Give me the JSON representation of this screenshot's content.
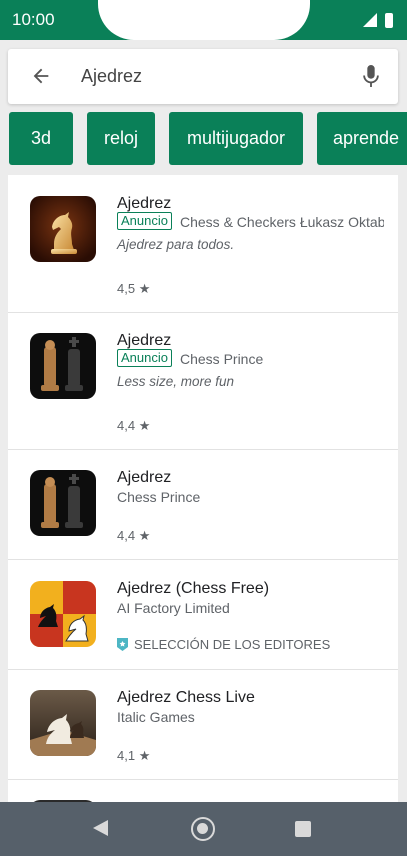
{
  "status": {
    "time": "10:00"
  },
  "search": {
    "query": "Ajedrez"
  },
  "chips": [
    {
      "label": "3d"
    },
    {
      "label": "reloj"
    },
    {
      "label": "multijugador"
    },
    {
      "label": "aprende"
    }
  ],
  "results": [
    {
      "title": "Ajedrez",
      "ad": "Anuncio",
      "developer": "Chess & Checkers Łukasz Oktaba",
      "description": "Ajedrez para todos.",
      "rating": "4,5",
      "star": "★"
    },
    {
      "title": "Ajedrez",
      "ad": "Anuncio",
      "developer": "Chess Prince",
      "description": "Less size, more fun",
      "rating": "4,4",
      "star": "★"
    },
    {
      "title": "Ajedrez",
      "developer": "Chess Prince",
      "rating": "4,4",
      "star": "★"
    },
    {
      "title": "Ajedrez (Chess Free)",
      "developer": "AI Factory Limited",
      "editors_choice": "SELECCIÓN DE LOS EDITORES"
    },
    {
      "title": "Ajedrez Chess Live",
      "developer": "Italic Games",
      "rating": "4,1",
      "star": "★"
    }
  ],
  "colors": {
    "accent": "#0a8058",
    "navbar": "#56606a"
  }
}
